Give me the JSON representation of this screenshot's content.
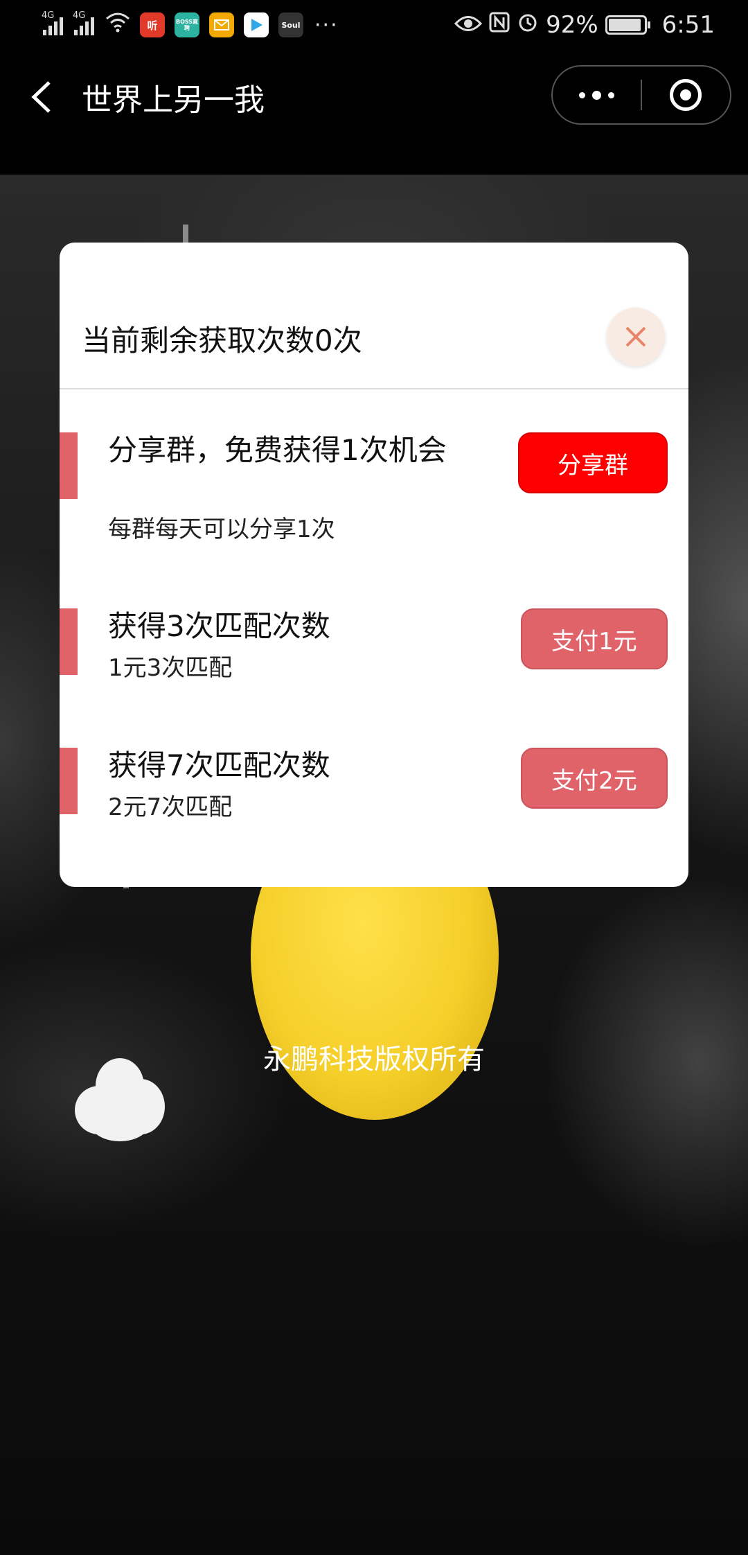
{
  "status_bar": {
    "network_1": "4G",
    "network_2": "4G",
    "app_icons": [
      "听",
      "BOSS直聘",
      "mail",
      "play",
      "Soul"
    ],
    "more": "···",
    "battery": "92%",
    "time": "6:51"
  },
  "title_bar": {
    "title": "世界上另一我"
  },
  "modal": {
    "title": "当前剩余获取次数0次",
    "options": [
      {
        "title": "分享群，免费获得1次机会",
        "subtitle": "每群每天可以分享1次",
        "button": "分享群"
      },
      {
        "title": "获得3次匹配次数",
        "subtitle": "1元3次匹配",
        "button": "支付1元"
      },
      {
        "title": "获得7次匹配次数",
        "subtitle": "2元7次匹配",
        "button": "支付2元"
      }
    ]
  },
  "footer": {
    "copyright": "永鹏科技版权所有"
  },
  "colors": {
    "accent": "#e0636a",
    "share_button": "#ff0000",
    "moon": "#f5cf2a"
  }
}
